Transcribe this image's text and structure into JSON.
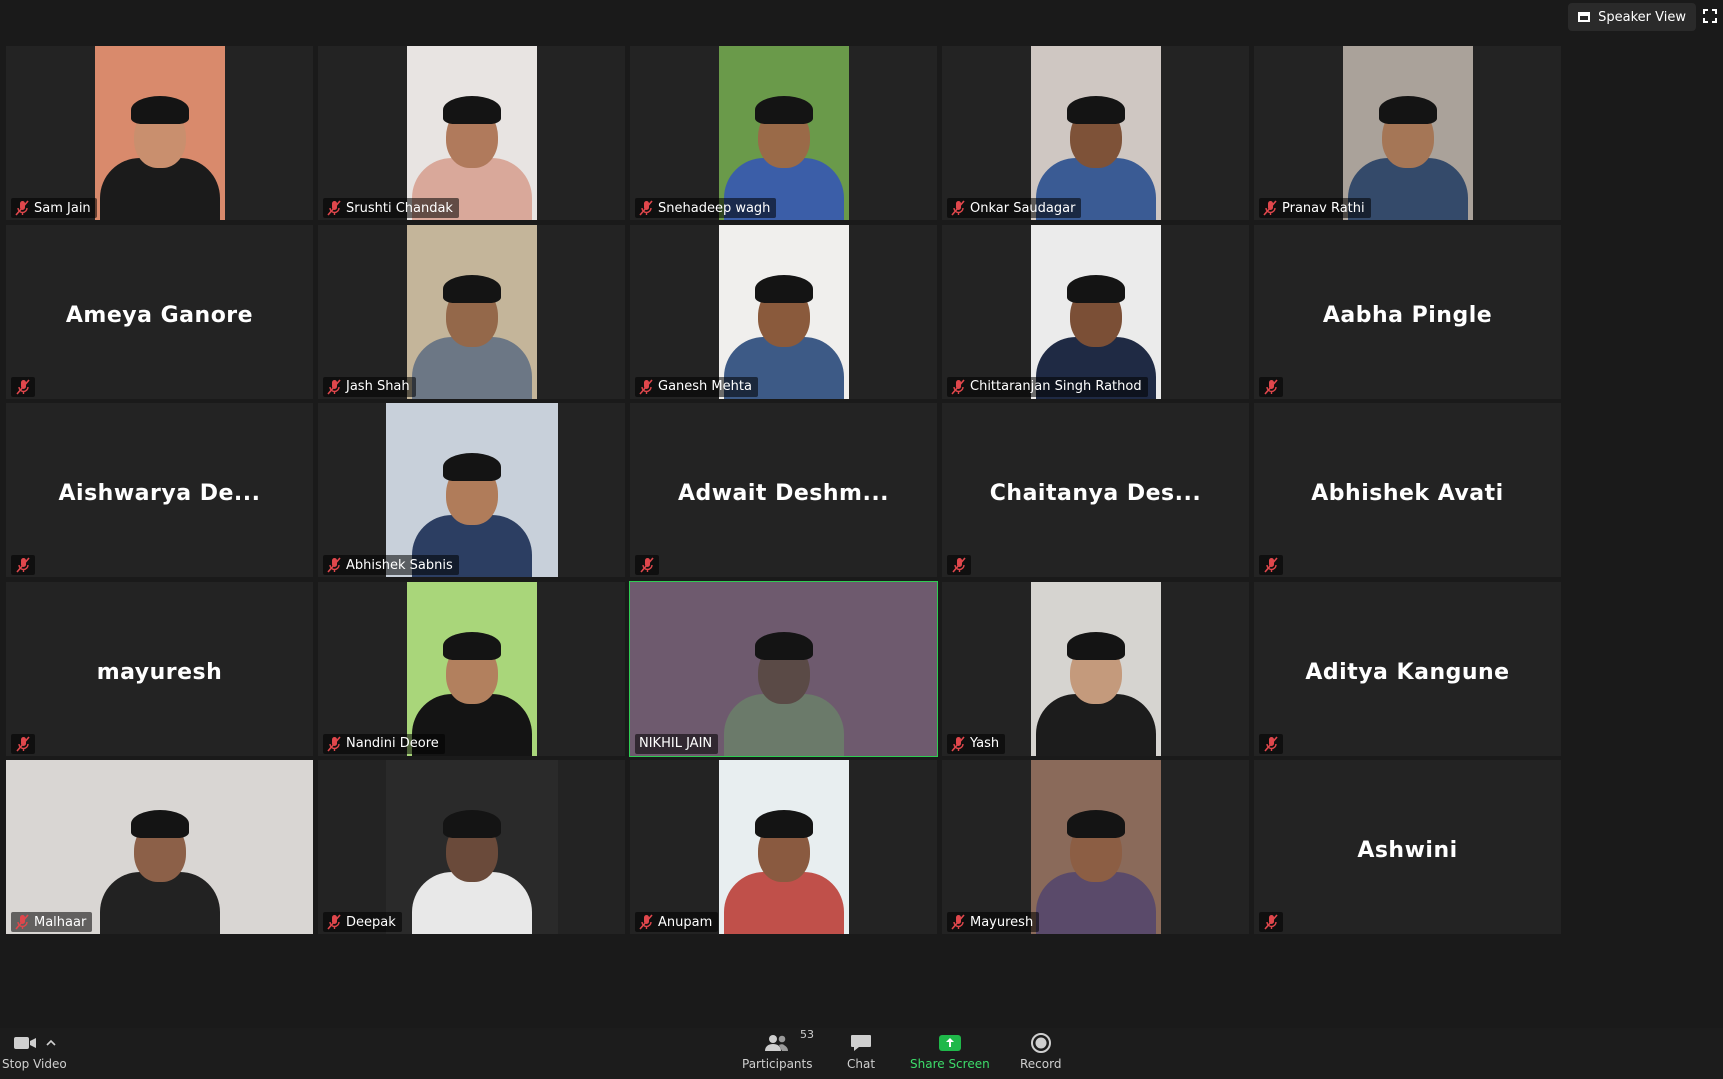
{
  "topbar": {
    "speaker_view_label": "Speaker View"
  },
  "participants": [
    {
      "name": "Sam Jain",
      "video": true,
      "muted": true,
      "bg": "#d98a6c",
      "skin": "#c98f6e",
      "shirt": "#1b1b1b"
    },
    {
      "name": "Srushti Chandak",
      "video": true,
      "muted": true,
      "bg": "#e8e4e2",
      "skin": "#b07a5c",
      "shirt": "#d9a89a"
    },
    {
      "name": "Snehadeep wagh",
      "video": true,
      "muted": true,
      "bg": "#6a9a4a",
      "skin": "#9a6a48",
      "shirt": "#3b5ea8"
    },
    {
      "name": "Onkar Saudagar",
      "video": true,
      "muted": true,
      "bg": "#cfc7c2",
      "skin": "#7e5238",
      "shirt": "#3a5b94"
    },
    {
      "name": "Pranav Rathi",
      "video": true,
      "muted": true,
      "bg": "#aaa29a",
      "skin": "#a57656",
      "shirt": "#344a6a"
    },
    {
      "name": "Ameya Ganore",
      "video": false,
      "muted": true
    },
    {
      "name": "Jash Shah",
      "video": true,
      "muted": true,
      "bg": "#c4b59a",
      "skin": "#94684a",
      "shirt": "#6c7785"
    },
    {
      "name": "Ganesh Mehta",
      "video": true,
      "muted": true,
      "bg": "#f0efed",
      "skin": "#8a5a3c",
      "shirt": "#3d5a86"
    },
    {
      "name": "Chittaranjan Singh Rathod",
      "video": true,
      "muted": true,
      "bg": "#ebebeb",
      "skin": "#7b4f36",
      "shirt": "#1f2a44"
    },
    {
      "name": "Aabha Pingle",
      "video": false,
      "muted": true
    },
    {
      "name": "Aishwarya De...",
      "video": false,
      "muted": true
    },
    {
      "name": "Abhishek Sabnis",
      "video": true,
      "muted": true,
      "bg": "#c8d0da",
      "skin": "#b07c5a",
      "shirt": "#2c3e62"
    },
    {
      "name": "Adwait Deshm...",
      "video": false,
      "muted": true
    },
    {
      "name": "Chaitanya Des...",
      "video": false,
      "muted": true
    },
    {
      "name": "Abhishek Avati",
      "video": false,
      "muted": true
    },
    {
      "name": "mayuresh",
      "video": false,
      "muted": true
    },
    {
      "name": "Nandini Deore",
      "video": true,
      "muted": true,
      "bg": "#a9d67a",
      "skin": "#b2805e",
      "shirt": "#141414"
    },
    {
      "name": "NIKHIL JAIN",
      "video": true,
      "muted": false,
      "active": true,
      "bg": "#6e5a6e",
      "skin": "#5a4a46",
      "shirt": "#6b7a6a"
    },
    {
      "name": "Yash",
      "video": true,
      "muted": true,
      "bg": "#d6d4d0",
      "skin": "#c49a7c",
      "shirt": "#1c1c1c"
    },
    {
      "name": "Aditya Kangune",
      "video": false,
      "muted": true
    },
    {
      "name": "Malhaar",
      "video": true,
      "muted": true,
      "bg": "#d9d6d3",
      "skin": "#8c6048",
      "shirt": "#222"
    },
    {
      "name": "Deepak",
      "video": true,
      "muted": true,
      "bg": "#2a2a2a",
      "skin": "#6a4a3a",
      "shirt": "#e8e8e8"
    },
    {
      "name": "Anupam",
      "video": true,
      "muted": true,
      "bg": "#e8eef0",
      "skin": "#8a5a40",
      "shirt": "#c0504a"
    },
    {
      "name": "Mayuresh",
      "video": true,
      "muted": true,
      "bg": "#8a6a5a",
      "skin": "#8c5e44",
      "shirt": "#5a4a6a"
    },
    {
      "name": "Ashwini",
      "video": false,
      "muted": true
    }
  ],
  "toolbar": {
    "stop_video": "Stop Video",
    "participants": "Participants",
    "participants_count": "53",
    "chat": "Chat",
    "share_screen": "Share Screen",
    "record": "Record"
  },
  "colors": {
    "active_border": "#2ecc52",
    "muted_icon": "#e0474c",
    "share_green": "#1fb84a"
  }
}
